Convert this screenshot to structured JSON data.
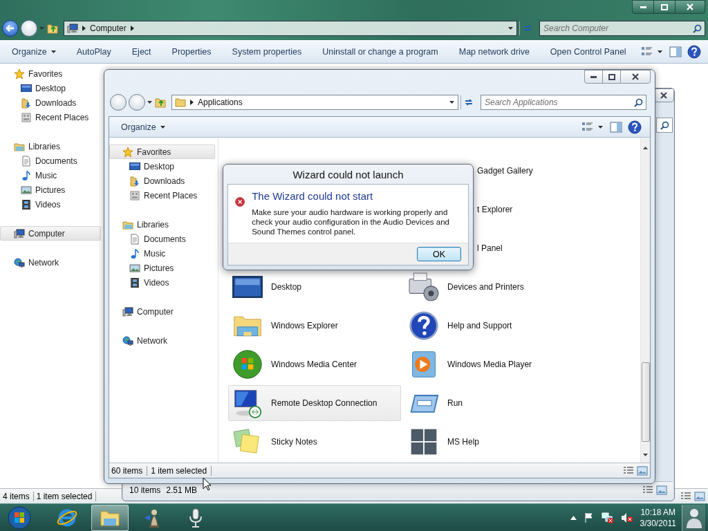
{
  "outer_window": {
    "address": {
      "back_enabled": true,
      "kind": "computer",
      "path": [
        "Computer"
      ],
      "trailing_menu": true
    },
    "search": {
      "placeholder": "Search Computer"
    },
    "toolbar": [
      {
        "label": "Organize",
        "menu": true
      },
      {
        "label": "AutoPlay",
        "menu": false
      },
      {
        "label": "Eject",
        "menu": false
      },
      {
        "label": "Properties",
        "menu": false
      },
      {
        "label": "System properties",
        "menu": false
      },
      {
        "label": "Uninstall or change a program",
        "menu": false
      },
      {
        "label": "Map network drive",
        "menu": false
      },
      {
        "label": "Open Control Panel",
        "menu": false
      }
    ],
    "nav": [
      {
        "label": "Favorites",
        "kind": "star",
        "selected": false,
        "children": [
          {
            "label": "Desktop",
            "kind": "desktop",
            "selected": false
          },
          {
            "label": "Downloads",
            "kind": "downloads",
            "selected": false
          },
          {
            "label": "Recent Places",
            "kind": "recent",
            "selected": false
          }
        ]
      },
      {
        "label": "Libraries",
        "kind": "library",
        "selected": false,
        "children": [
          {
            "label": "Documents",
            "kind": "documents",
            "selected": false
          },
          {
            "label": "Music",
            "kind": "music",
            "selected": false
          },
          {
            "label": "Pictures",
            "kind": "pictures",
            "selected": false
          },
          {
            "label": "Videos",
            "kind": "videos",
            "selected": false
          }
        ]
      },
      {
        "label": "Computer",
        "kind": "computer",
        "selected": true
      },
      {
        "label": "Network",
        "kind": "network",
        "selected": false
      }
    ],
    "status_bar": {
      "items": "4 items",
      "selection": "1 item selected"
    }
  },
  "back_window": {
    "status_bar": {
      "items": "10 items",
      "size": "2.51 MB"
    }
  },
  "explorer_window": {
    "address": {
      "back_enabled": false,
      "kind": "folder",
      "path": [
        "Applications"
      ],
      "trailing_menu": false
    },
    "search": {
      "placeholder": "Search Applications"
    },
    "toolbar": [
      {
        "label": "Organize",
        "menu": true
      }
    ],
    "nav": [
      {
        "label": "Favorites",
        "kind": "star",
        "selected": true,
        "children": [
          {
            "label": "Desktop",
            "kind": "desktop",
            "selected": false
          },
          {
            "label": "Downloads",
            "kind": "downloads",
            "selected": false
          },
          {
            "label": "Recent Places",
            "kind": "recent",
            "selected": false
          }
        ]
      },
      {
        "label": "Libraries",
        "kind": "library",
        "selected": false,
        "children": [
          {
            "label": "Documents",
            "kind": "documents",
            "selected": false
          },
          {
            "label": "Music",
            "kind": "music",
            "selected": false
          },
          {
            "label": "Pictures",
            "kind": "pictures",
            "selected": false
          },
          {
            "label": "Videos",
            "kind": "videos",
            "selected": false
          }
        ]
      },
      {
        "label": "Computer",
        "kind": "computer",
        "selected": false
      },
      {
        "label": "Network",
        "kind": "network",
        "selected": false
      }
    ],
    "items": [
      {
        "kind": "covered",
        "label": "Gadget Gallery",
        "selected": false
      },
      {
        "kind": "covered",
        "label": "t Explorer",
        "selected": false
      },
      {
        "kind": "covered",
        "label": "l Panel",
        "selected": false
      },
      {
        "kind": "desktop",
        "label": "Desktop",
        "selected": false
      },
      {
        "kind": "devices",
        "label": "Devices and Printers",
        "selected": false
      },
      {
        "kind": "explorer",
        "label": "Windows Explorer",
        "selected": false
      },
      {
        "kind": "help",
        "label": "Help and Support",
        "selected": false
      },
      {
        "kind": "mediacenter",
        "label": "Windows Media Center",
        "selected": false
      },
      {
        "kind": "mediaplayer",
        "label": "Windows Media Player",
        "selected": false
      },
      {
        "kind": "remote",
        "label": "Remote Desktop Connection",
        "selected": true
      },
      {
        "kind": "run",
        "label": "Run",
        "selected": false
      },
      {
        "kind": "sticky",
        "label": "Sticky Notes",
        "selected": false
      },
      {
        "kind": "mshelp",
        "label": "MS Help",
        "selected": false
      }
    ],
    "status_bar": {
      "items": "60 items",
      "selection": "1 item selected"
    }
  },
  "dialog": {
    "title": "Wizard could not launch",
    "heading": "The Wizard could not start",
    "message": "Make sure your audio hardware is working properly and check your audio configuration in the Audio Devices and Sound Themes control panel.",
    "buttons": [
      {
        "label": "OK",
        "default": true
      }
    ]
  },
  "taskbar": {
    "apps": [
      {
        "kind": "ie",
        "active": false
      },
      {
        "kind": "explorer",
        "active": true
      },
      {
        "kind": "chess",
        "active": false
      },
      {
        "kind": "mic",
        "active": false
      }
    ],
    "clock": {
      "time": "10:18 AM",
      "date": "3/30/2011"
    }
  }
}
